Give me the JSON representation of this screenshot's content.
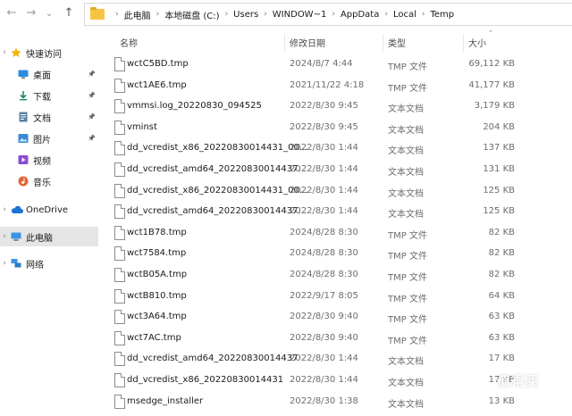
{
  "nav": {
    "back_icon": "←",
    "forward_icon": "→",
    "dropdown_icon": "⌄",
    "up_icon": "↑"
  },
  "breadcrumb": [
    "此电脑",
    "本地磁盘 (C:)",
    "Users",
    "WINDOW~1",
    "AppData",
    "Local",
    "Temp"
  ],
  "sidebar": {
    "items": [
      {
        "label": "快速访问",
        "icon": "star-icon",
        "level": 0,
        "pinned": false,
        "chev": true
      },
      {
        "label": "桌面",
        "icon": "desktop-icon",
        "level": 1,
        "pinned": true,
        "chev": false
      },
      {
        "label": "下载",
        "icon": "download-icon",
        "level": 1,
        "pinned": true,
        "chev": false
      },
      {
        "label": "文档",
        "icon": "documents-icon",
        "level": 1,
        "pinned": true,
        "chev": false
      },
      {
        "label": "图片",
        "icon": "pictures-icon",
        "level": 1,
        "pinned": true,
        "chev": false
      },
      {
        "label": "视频",
        "icon": "videos-icon",
        "level": 1,
        "pinned": false,
        "chev": false
      },
      {
        "label": "音乐",
        "icon": "music-icon",
        "level": 1,
        "pinned": false,
        "chev": false
      },
      {
        "label": "OneDrive",
        "icon": "onedrive-icon",
        "level": 0,
        "pinned": false,
        "chev": true
      },
      {
        "label": "此电脑",
        "icon": "this-pc-icon",
        "level": 0,
        "pinned": false,
        "chev": true,
        "selected": true
      },
      {
        "label": "网络",
        "icon": "network-icon",
        "level": 0,
        "pinned": false,
        "chev": true
      }
    ]
  },
  "columns": {
    "name": "名称",
    "modified": "修改日期",
    "type": "类型",
    "size": "大小"
  },
  "files": [
    {
      "name": "wctC5BD.tmp",
      "modified": "2024/8/7 4:44",
      "type": "TMP 文件",
      "size": "69,112 KB"
    },
    {
      "name": "wct1AE6.tmp",
      "modified": "2021/11/22 4:18",
      "type": "TMP 文件",
      "size": "41,177 KB"
    },
    {
      "name": "vmmsi.log_20220830_094525",
      "modified": "2022/8/30 9:45",
      "type": "文本文档",
      "size": "3,179 KB"
    },
    {
      "name": "vminst",
      "modified": "2022/8/30 9:45",
      "type": "文本文档",
      "size": "204 KB"
    },
    {
      "name": "dd_vcredist_x86_20220830014431_00...",
      "modified": "2022/8/30 1:44",
      "type": "文本文档",
      "size": "137 KB"
    },
    {
      "name": "dd_vcredist_amd64_20220830014437...",
      "modified": "2022/8/30 1:44",
      "type": "文本文档",
      "size": "131 KB"
    },
    {
      "name": "dd_vcredist_x86_20220830014431_00...",
      "modified": "2022/8/30 1:44",
      "type": "文本文档",
      "size": "125 KB"
    },
    {
      "name": "dd_vcredist_amd64_20220830014437...",
      "modified": "2022/8/30 1:44",
      "type": "文本文档",
      "size": "125 KB"
    },
    {
      "name": "wct1B78.tmp",
      "modified": "2024/8/28 8:30",
      "type": "TMP 文件",
      "size": "82 KB"
    },
    {
      "name": "wct7584.tmp",
      "modified": "2024/8/28 8:30",
      "type": "TMP 文件",
      "size": "82 KB"
    },
    {
      "name": "wctB05A.tmp",
      "modified": "2024/8/28 8:30",
      "type": "TMP 文件",
      "size": "82 KB"
    },
    {
      "name": "wctB810.tmp",
      "modified": "2022/9/17 8:05",
      "type": "TMP 文件",
      "size": "64 KB"
    },
    {
      "name": "wct3A64.tmp",
      "modified": "2022/8/30 9:40",
      "type": "TMP 文件",
      "size": "63 KB"
    },
    {
      "name": "wct7AC.tmp",
      "modified": "2022/8/30 9:40",
      "type": "TMP 文件",
      "size": "63 KB"
    },
    {
      "name": "dd_vcredist_amd64_20220830014437",
      "modified": "2022/8/30 1:44",
      "type": "文本文档",
      "size": "17 KB"
    },
    {
      "name": "dd_vcredist_x86_20220830014431",
      "modified": "2022/8/30 1:44",
      "type": "文本文档",
      "size": "17 KB"
    },
    {
      "name": "msedge_installer",
      "modified": "2022/8/30 1:38",
      "type": "文本文档",
      "size": "13 KB"
    }
  ],
  "watermark": "值得买"
}
